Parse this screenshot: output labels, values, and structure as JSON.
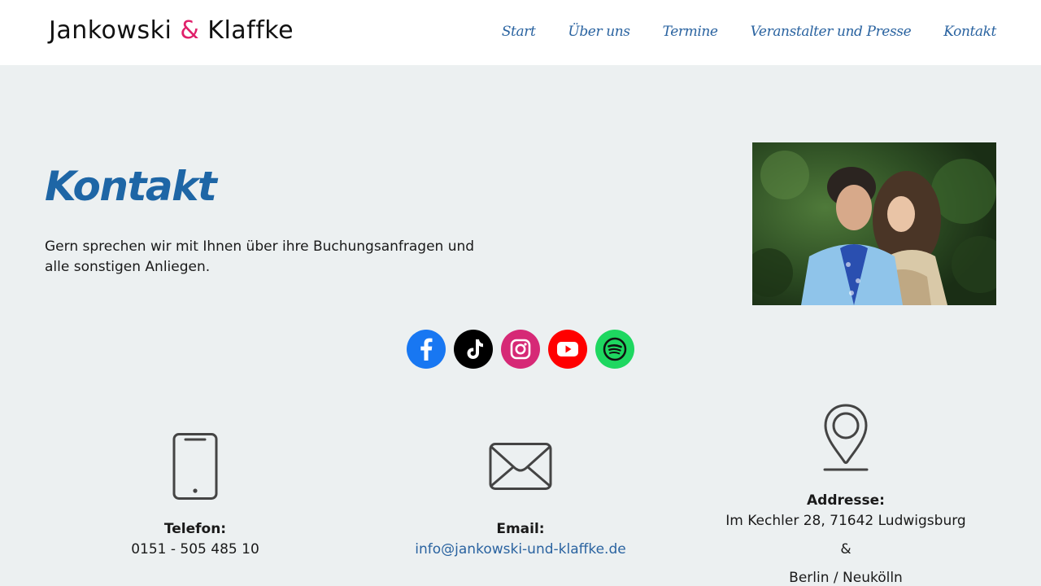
{
  "header": {
    "logo": {
      "left": "Jankowski",
      "amp": "&",
      "right": "Klaffke"
    },
    "nav": [
      "Start",
      "Über uns",
      "Termine",
      "Veranstalter und Presse",
      "Kontakt"
    ]
  },
  "main": {
    "title": "Kontakt",
    "intro": "Gern sprechen wir mit Ihnen über ihre Buchungsanfragen und alle sonstigen Anliegen."
  },
  "social": [
    {
      "name": "facebook-icon",
      "color": "#1877f2"
    },
    {
      "name": "tiktok-icon",
      "color": "#000000"
    },
    {
      "name": "instagram-icon",
      "color": "#d62976"
    },
    {
      "name": "youtube-icon",
      "color": "#ff0000"
    },
    {
      "name": "spotify-icon",
      "color": "#1ed760"
    }
  ],
  "contact": {
    "phone": {
      "icon": "phone-icon",
      "label": "Telefon:",
      "value": "0151 - 505 485 10"
    },
    "email": {
      "icon": "envelope-icon",
      "label": "Email:",
      "value": "info@jankowski-und-klaffke.de"
    },
    "address": {
      "icon": "map-pin-icon",
      "label": "Addresse:",
      "line1": "Im Kechler 28, 71642 Ludwigsburg",
      "amp": "&",
      "line2": "Berlin / Neukölln"
    }
  },
  "colors": {
    "accent": "#1e66a6",
    "link": "#2a63a0",
    "logo_amp": "#e0206a",
    "background": "#ecf0f1"
  }
}
